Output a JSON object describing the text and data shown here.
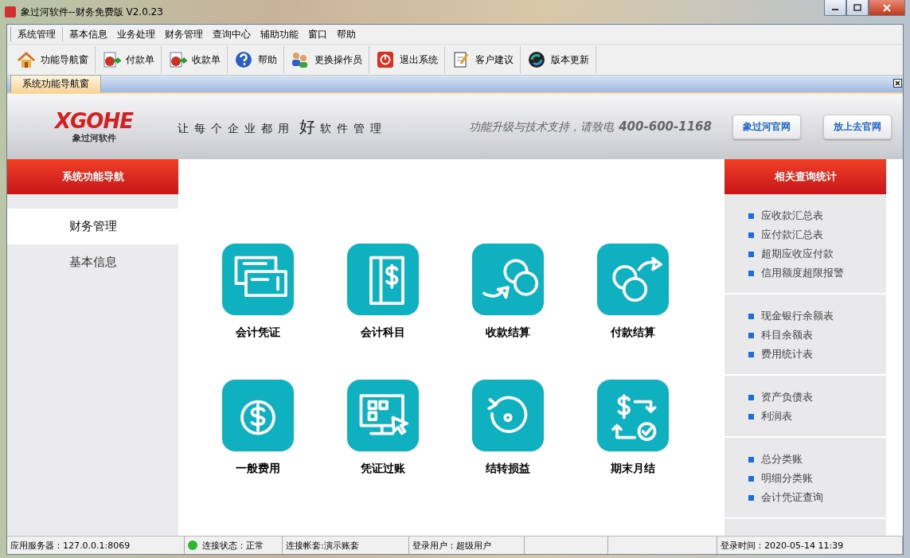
{
  "window": {
    "title": "象过河软件--财务免费版 V2.0.23"
  },
  "menu": [
    "系统管理",
    "基本信息",
    "业务处理",
    "财务管理",
    "查询中心",
    "辅助功能",
    "窗口",
    "帮助"
  ],
  "toolbar": [
    {
      "label": "功能导航窗"
    },
    {
      "label": "付款单"
    },
    {
      "label": "收款单"
    },
    {
      "label": "帮助"
    },
    {
      "label": "更换操作员"
    },
    {
      "label": "退出系统"
    },
    {
      "label": "客户建议"
    },
    {
      "label": "版本更新"
    }
  ],
  "doc_tabs": [
    {
      "label": "系统功能导航窗",
      "selected": true
    }
  ],
  "header": {
    "logo": "XGOHE",
    "logo_sub": "象过河软件",
    "slogan_before": "让每个企业都用",
    "slogan_big": "好",
    "slogan_after": "软件管理",
    "support": "功能升级与技术支持，请致电",
    "phone": "400-600-1168",
    "buttons": [
      "象过河官网",
      "放上去官网"
    ]
  },
  "left_nav": {
    "title": "系统功能导航",
    "items": [
      {
        "label": "财务管理",
        "selected": true
      },
      {
        "label": "基本信息",
        "selected": false
      }
    ]
  },
  "tiles": [
    {
      "label": "会计凭证"
    },
    {
      "label": "会计科目"
    },
    {
      "label": "收款结算"
    },
    {
      "label": "付款结算"
    },
    {
      "label": "一般费用"
    },
    {
      "label": "凭证过账"
    },
    {
      "label": "结转损益"
    },
    {
      "label": "期末月结"
    }
  ],
  "right_panel": {
    "title": "相关查询统计",
    "groups": [
      [
        "应收款汇总表",
        "应付款汇总表",
        "超期应收应付款",
        "信用额度超限报警"
      ],
      [
        "现金银行余额表",
        "科目余额表",
        "费用统计表"
      ],
      [
        "资产负债表",
        "利润表"
      ],
      [
        "总分类账",
        "明细分类账",
        "会计凭证查询"
      ]
    ]
  },
  "status_bar": [
    {
      "text": "应用服务器：127.0.0.1:8069",
      "kind": "text"
    },
    {
      "text": "连接状态：正常",
      "kind": "connection",
      "color": "#2db82d"
    },
    {
      "text": "连接帐套:演示账套",
      "kind": "text"
    },
    {
      "text": "登录用户：超级用户",
      "kind": "text"
    },
    {
      "kind": "empty"
    },
    {
      "kind": "empty"
    },
    {
      "text": "登录时间：2020-05-14 11:39",
      "kind": "text"
    }
  ]
}
